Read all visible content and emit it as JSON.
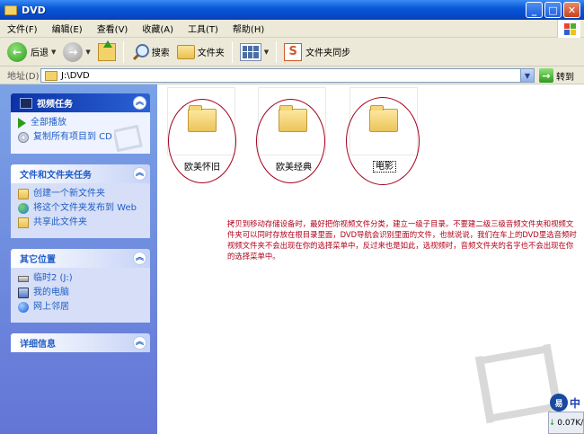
{
  "window": {
    "title": "DVD"
  },
  "menu": [
    "文件(F)",
    "编辑(E)",
    "查看(V)",
    "收藏(A)",
    "工具(T)",
    "帮助(H)"
  ],
  "toolbar": {
    "back_label": "后退",
    "search_label": "搜索",
    "folders_label": "文件夹",
    "sync_label": "文件夹同步"
  },
  "address": {
    "label": "地址(D)",
    "path": "J:\\DVD",
    "go_label": "转到"
  },
  "panels": {
    "video_tasks": {
      "title": "视频任务",
      "items": [
        "全部播放",
        "复制所有项目到 CD"
      ]
    },
    "file_tasks": {
      "title": "文件和文件夹任务",
      "items": [
        "创建一个新文件夹",
        "将这个文件夹发布到 Web",
        "共享此文件夹"
      ]
    },
    "other_places": {
      "title": "其它位置",
      "items": [
        "临时2 (J:)",
        "我的电脑",
        "网上邻居"
      ]
    },
    "details": {
      "title": "详细信息"
    }
  },
  "folders": [
    "欧美怀旧",
    "欧美经典",
    "电影"
  ],
  "note_text": "拷贝到移动存储设备时，最好把你视频文件分类，建立一级子目录。不要建二级三级音频文件夹和视频文件夹可以同时存放在根目录里面，DVD导航会识别里面的文件，也就说说，我们在车上的DVD里选音频时视频文件夹不会出现在你的选择菜单中，反过来也是如此，选视频时，音频文件夹的名字也不会出现在你的选择菜单中。",
  "status": {
    "speed": "0.07K/",
    "badge_text": "中"
  },
  "colors": {
    "titlebar": "#0a58d8",
    "task_link": "#215dc6",
    "annotation": "#b0001a"
  }
}
